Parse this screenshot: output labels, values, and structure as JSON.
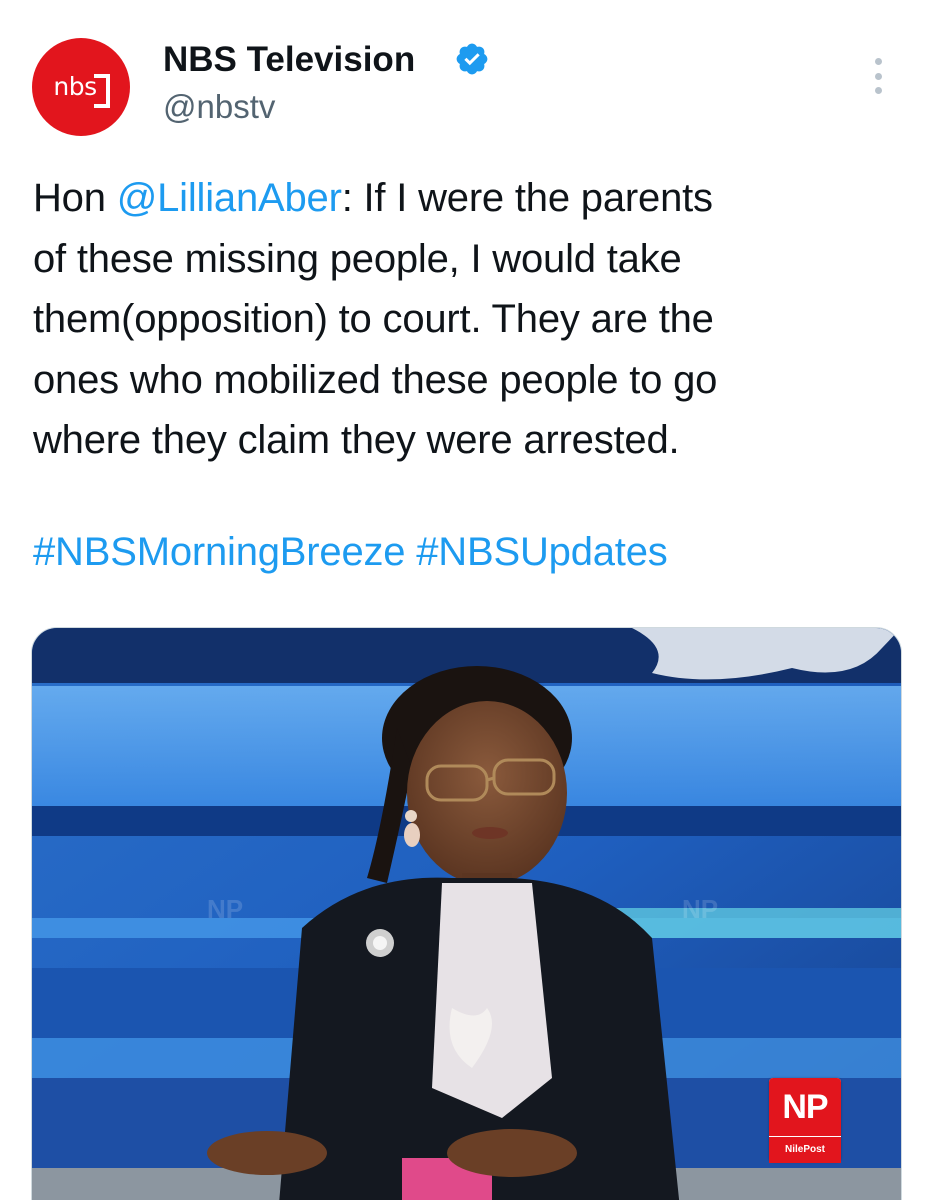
{
  "author": {
    "display_name": "NBS Television",
    "handle": "@nbstv",
    "avatar_text": "nbs",
    "verified": true
  },
  "tweet": {
    "prefix": "Hon ",
    "mention": "@LillianAber",
    "line1_rest": ": If I were the parents",
    "line2": "of these missing people, I would take",
    "line3": "them(opposition) to court. They are the",
    "line4": "ones who mobilized these people to go",
    "line5": "where they claim they were arrested.",
    "hashtags": [
      "#NBSMorningBreeze",
      "#NBSUpdates"
    ]
  },
  "media": {
    "description": "photo",
    "watermark_logo": "NP",
    "watermark_name": "NilePost"
  },
  "colors": {
    "link": "#1d9bf0",
    "brand_red": "#e2151d",
    "secondary_text": "#536471"
  }
}
